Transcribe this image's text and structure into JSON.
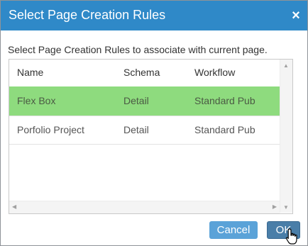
{
  "dialog": {
    "title": "Select Page Creation Rules",
    "close_icon": "×",
    "instructions": "Select Page Creation Rules to associate with current page."
  },
  "grid": {
    "columns": [
      "Name",
      "Schema",
      "Workflow"
    ],
    "rows": [
      {
        "name": "Flex Box",
        "schema": "Detail",
        "workflow": "Standard Pub",
        "selected": true
      },
      {
        "name": "Porfolio Project",
        "schema": "Detail",
        "workflow": "Standard Pub",
        "selected": false
      }
    ]
  },
  "buttons": {
    "cancel_label": "Cancel",
    "ok_label": "OK"
  },
  "colors": {
    "titlebar": "#2f89c8",
    "selected_row": "#8edb7e",
    "cancel_button": "#5aa2d8",
    "ok_button": "#4a7ea8"
  },
  "icons": {
    "close": "close-icon",
    "cursor": "hand-pointer-icon"
  }
}
